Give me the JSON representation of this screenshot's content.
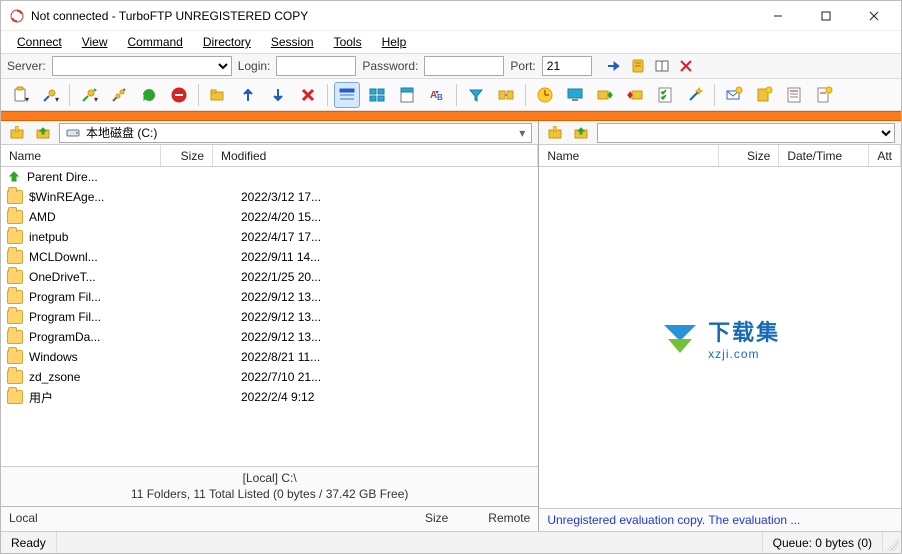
{
  "titlebar": {
    "title": "Not connected - TurboFTP UNREGISTERED COPY"
  },
  "menu": {
    "connect": "Connect",
    "view": "View",
    "command": "Command",
    "directory": "Directory",
    "session": "Session",
    "tools": "Tools",
    "help": "Help"
  },
  "conn": {
    "server_label": "Server:",
    "server_value": "",
    "login_label": "Login:",
    "login_value": "",
    "password_label": "Password:",
    "password_value": "",
    "port_label": "Port:",
    "port_value": "21"
  },
  "local": {
    "path_display": "本地磁盘 (C:)",
    "columns": {
      "name": "Name",
      "size": "Size",
      "modified": "Modified"
    },
    "parent_label": "Parent Dire...",
    "rows": [
      {
        "name": "$WinREAge...",
        "modified": "2022/3/12 17..."
      },
      {
        "name": "AMD",
        "modified": "2022/4/20 15..."
      },
      {
        "name": "inetpub",
        "modified": "2022/4/17 17..."
      },
      {
        "name": "MCLDownl...",
        "modified": "2022/9/11 14..."
      },
      {
        "name": "OneDriveT...",
        "modified": "2022/1/25 20..."
      },
      {
        "name": "Program Fil...",
        "modified": "2022/9/12 13..."
      },
      {
        "name": "Program Fil...",
        "modified": "2022/9/12 13..."
      },
      {
        "name": "ProgramDa...",
        "modified": "2022/9/12 13..."
      },
      {
        "name": "Windows",
        "modified": "2022/8/21 11..."
      },
      {
        "name": "zd_zsone",
        "modified": "2022/7/10 21..."
      },
      {
        "name": "用户",
        "modified": "2022/2/4 9:12"
      }
    ],
    "footer_line1": "[Local] C:\\",
    "footer_line2": "11 Folders, 11 Total Listed (0 bytes / 37.42 GB Free)",
    "mini_local": "Local",
    "mini_size": "Size",
    "mini_remote": "Remote"
  },
  "remote": {
    "columns": {
      "name": "Name",
      "size": "Size",
      "datetime": "Date/Time",
      "attr": "Att"
    },
    "watermark_title": "下载集",
    "watermark_sub": "xzji.com",
    "eval_message": "Unregistered evaluation copy. The evaluation ..."
  },
  "status": {
    "ready": "Ready",
    "queue": "Queue: 0 bytes  (0)"
  }
}
